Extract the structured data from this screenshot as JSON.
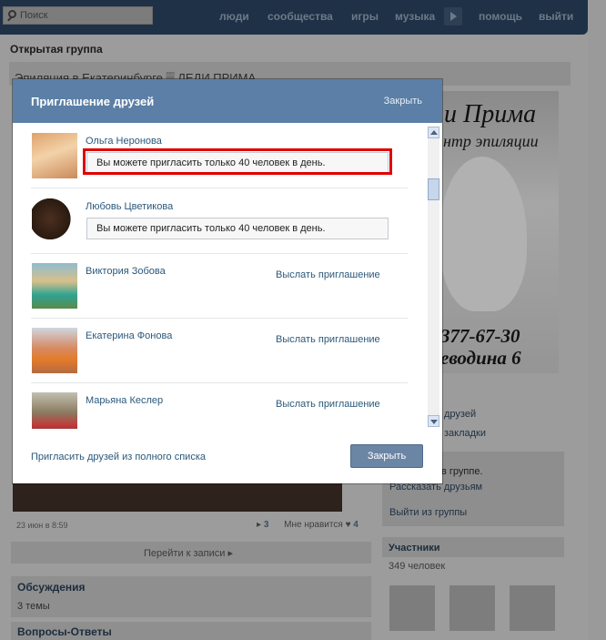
{
  "topbar": {
    "search_placeholder": "Поиск",
    "nav": [
      "люди",
      "сообщества",
      "игры",
      "музыка",
      "помощь",
      "выйти"
    ]
  },
  "page": {
    "group_type": "Открытая группа",
    "group_title": "Эпиляция в Екатеринбурге ▒ ЛЕДИ ПРИМА",
    "banner": {
      "title": "и Прима",
      "subtitle": "нтр эпиляции",
      "phone": "377-67-30",
      "address": "еводина 6"
    },
    "right_links": {
      "friends": "друзей",
      "bookmarks": "закладки",
      "in_group": "в группе.",
      "tell_friends": "Рассказать друзьям",
      "leave": "Выйти из группы"
    },
    "members": {
      "title": "Участники",
      "count": "349 человек"
    },
    "post": {
      "date": "23 июн в 8:59",
      "share_count": "3",
      "like_label": "Мне нравится",
      "like_count": "4",
      "goto": "Перейти к записи"
    },
    "discussions": {
      "title": "Обсуждения",
      "count": "3 темы"
    },
    "qa": {
      "title": "Вопросы-Ответы"
    }
  },
  "modal": {
    "title": "Приглашение друзей",
    "close_link": "Закрыть",
    "limit_message": "Вы можете пригласить только 40 человек в день.",
    "invite_label": "Выслать приглашение",
    "friends": [
      {
        "name": "Ольга Неронова"
      },
      {
        "name": "Любовь Цветикова"
      },
      {
        "name": "Виктория Зобова"
      },
      {
        "name": "Екатерина Фонова"
      },
      {
        "name": "Марьяна Кеслер"
      }
    ],
    "full_list_link": "Пригласить друзей из полного списка",
    "close_button": "Закрыть"
  },
  "colors": {
    "header_blue": "#5b7fa6",
    "link_blue": "#2b587a",
    "highlight_red": "#e00000",
    "topbar": "#1f3146"
  }
}
